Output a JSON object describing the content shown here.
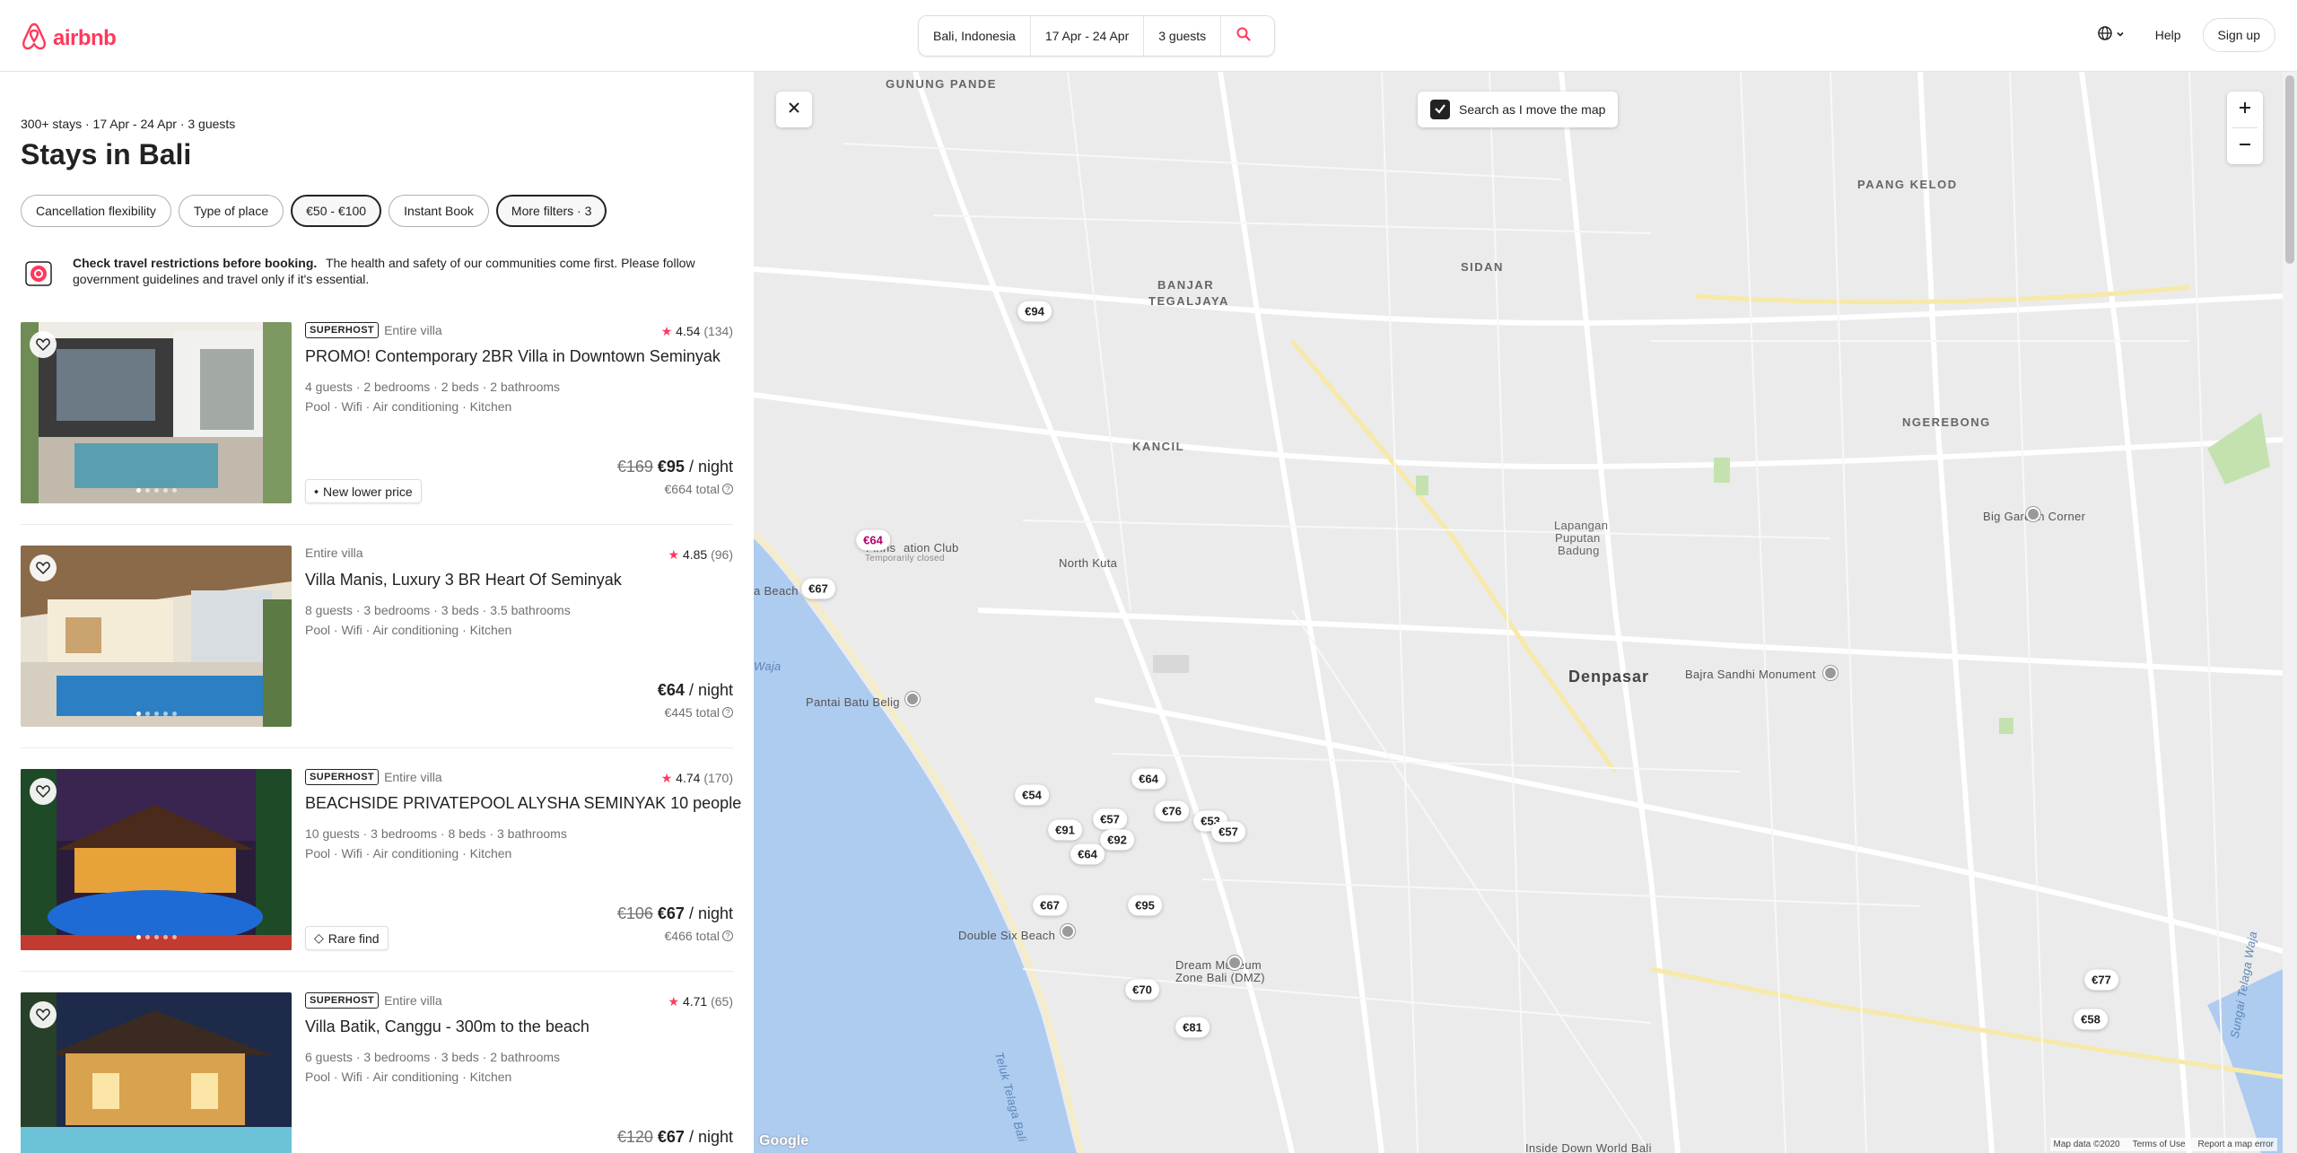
{
  "header": {
    "logo_text": "airbnb",
    "search": {
      "location": "Bali, Indonesia",
      "dates": "17 Apr - 24 Apr",
      "guests": "3 guests"
    },
    "help": "Help",
    "signup": "Sign up"
  },
  "results": {
    "summary": "300+ stays · 17 Apr - 24 Apr · 3 guests",
    "title": "Stays in Bali",
    "filters": [
      {
        "label": "Cancellation flexibility",
        "active": false
      },
      {
        "label": "Type of place",
        "active": false
      },
      {
        "label": "€50 - €100",
        "active": true
      },
      {
        "label": "Instant Book",
        "active": false
      },
      {
        "label": "More filters · 3",
        "active": true
      }
    ],
    "notice": {
      "bold": "Check travel restrictions before booking.",
      "text": "The health and safety of our communities come first. Please follow government guidelines and travel only if it's essential."
    }
  },
  "listings": [
    {
      "superhost": "SUPERHOST",
      "type": "Entire villa",
      "rating": "4.54",
      "reviews": "(134)",
      "title": "PROMO! Contemporary 2BR Villa in Downtown Seminyak",
      "details": "4 guests · 2 bedrooms · 2 beds · 2 bathrooms",
      "amenities": "Pool · Wifi · Air conditioning · Kitchen",
      "badge": "New lower price",
      "old_price": "€169",
      "price": "€95",
      "per": "/ night",
      "total": "€664 total"
    },
    {
      "superhost": "",
      "type": "Entire villa",
      "rating": "4.85",
      "reviews": "(96)",
      "title": "Villa Manis, Luxury 3 BR Heart Of Seminyak",
      "details": "8 guests · 3 bedrooms · 3 beds · 3.5 bathrooms",
      "amenities": "Pool · Wifi · Air conditioning · Kitchen",
      "badge": "",
      "old_price": "",
      "price": "€64",
      "per": "/ night",
      "total": "€445 total"
    },
    {
      "superhost": "SUPERHOST",
      "type": "Entire villa",
      "rating": "4.74",
      "reviews": "(170)",
      "title": "BEACHSIDE PRIVATEPOOL ALYSHA SEMINYAK 10 people",
      "details": "10 guests · 3 bedrooms · 8 beds · 3 bathrooms",
      "amenities": "Pool · Wifi · Air conditioning · Kitchen",
      "badge": "Rare find",
      "old_price": "€106",
      "price": "€67",
      "per": "/ night",
      "total": "€466 total"
    },
    {
      "superhost": "SUPERHOST",
      "type": "Entire villa",
      "rating": "4.71",
      "reviews": "(65)",
      "title": "Villa Batik, Canggu - 300m to the beach",
      "details": "6 guests · 3 bedrooms · 3 beds · 2 bathrooms",
      "amenities": "Pool · Wifi · Air conditioning · Kitchen",
      "badge": "",
      "old_price": "€120",
      "price": "€67",
      "per": "/ night",
      "total": ""
    }
  ],
  "map": {
    "search_toggle": "Search as I move the map",
    "pins": [
      "€94",
      "€64",
      "€67",
      "€54",
      "€64",
      "€57",
      "€76",
      "€53",
      "€57",
      "€91",
      "€92",
      "€64",
      "€67",
      "€95",
      "€70",
      "€81",
      "€77",
      "€58"
    ],
    "labels": {
      "gunung_pande": "GUNUNG PANDE",
      "paang_kelod": "PAANG KELOD",
      "sidan": "SIDAN",
      "banjar": "BANJAR",
      "tegaljaya": "TEGALJAYA",
      "kancil": "KANCIL",
      "ngerebong": "NGEREBONG",
      "north_kuta": "North Kuta",
      "finns": "Finns",
      "finns2": "ation Club",
      "finns3": "Temporarily closed",
      "lapangan": "Lapangan",
      "puputan": "Puputan",
      "badung": "Badung",
      "big_garden": "Big Garden Corner",
      "denpasar": "Denpasar",
      "bajra": "Bajra Sandhi Monument",
      "pantai": "Pantai Batu Belig",
      "a_beach": "a Beach",
      "double_six": "Double Six Beach",
      "dream1": "Dream Museum",
      "dream2": "Zone Bali (DMZ)",
      "waves": "Waja",
      "teluk": "Teluk Telaga Bali",
      "sungai": "Sungai Telaga Waja",
      "inside_down": "Inside Down World Bali"
    },
    "google": "Google",
    "map_data": "Map data ©2020",
    "terms": "Terms of Use",
    "report": "Report a map error"
  },
  "icons": [
    "airbnb-logo-icon",
    "search-icon",
    "globe-icon",
    "chevron-down-icon",
    "heart-icon",
    "star-icon",
    "close-icon",
    "check-icon",
    "plus-icon",
    "minus-icon",
    "travel-notice-icon"
  ],
  "colors": {
    "brand": "#ff385c",
    "visited_pin": "#b4006e",
    "map_bg": "#ececec",
    "water": "#aecbf0",
    "park": "#c4e2b0"
  }
}
